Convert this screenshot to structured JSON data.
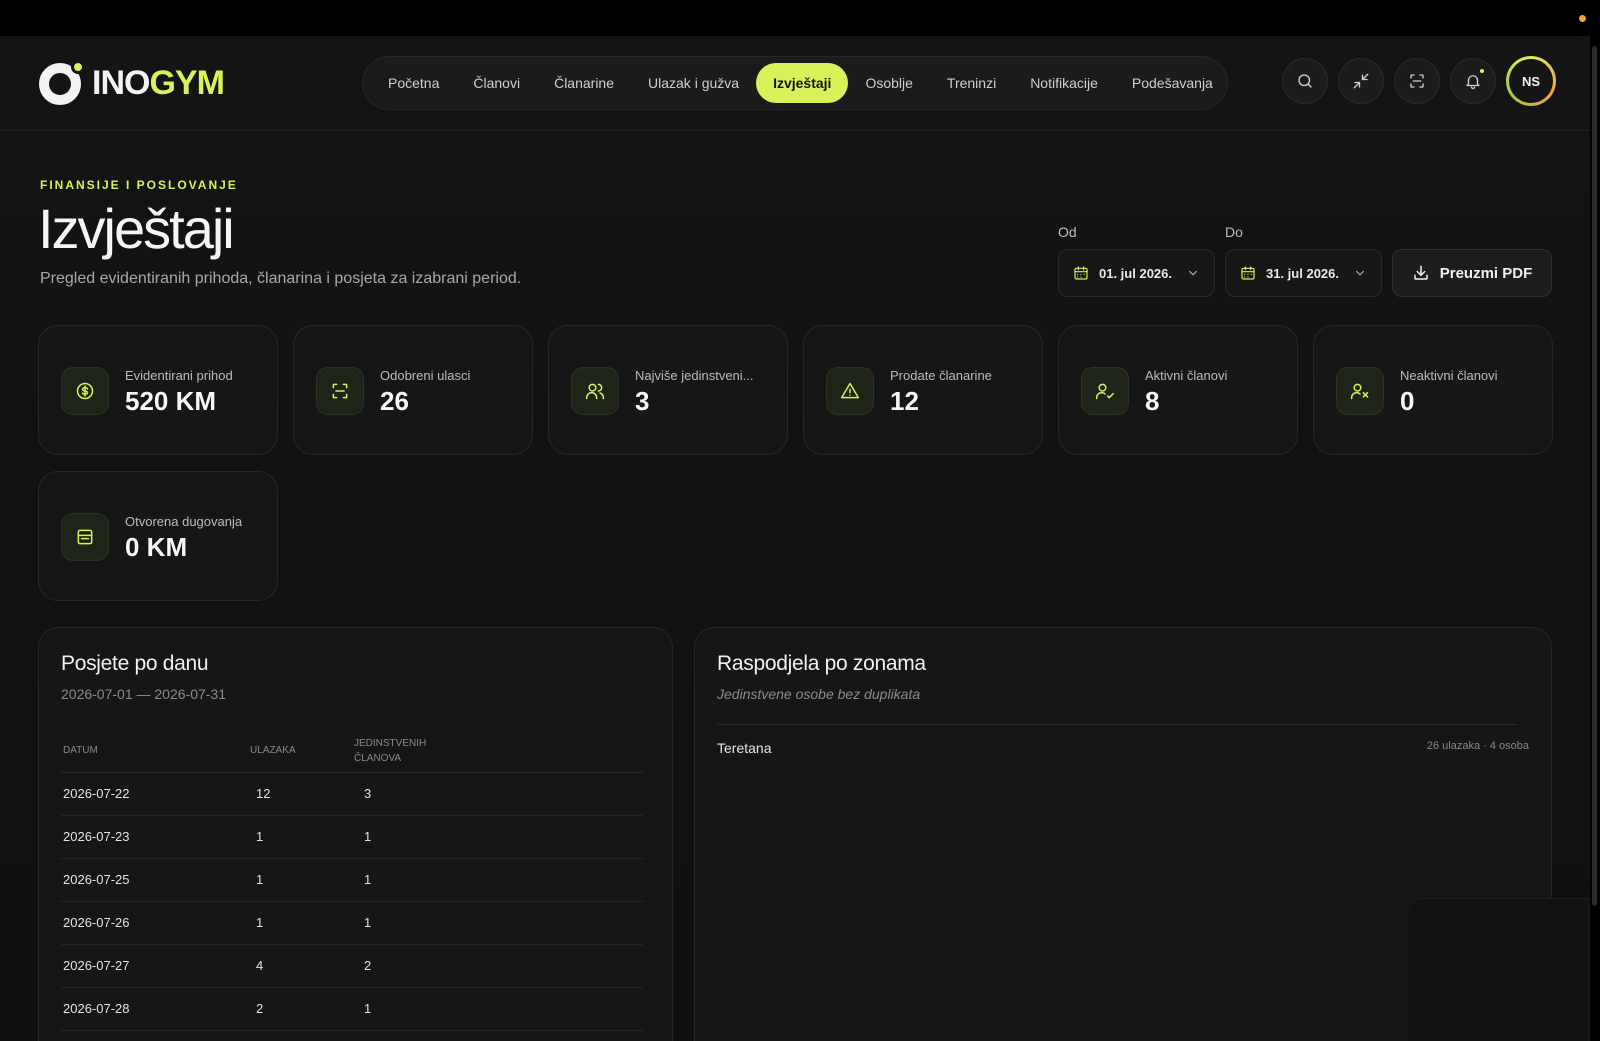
{
  "brand": {
    "name_part1": "INO",
    "name_part2": "GYM"
  },
  "nav": {
    "items": [
      {
        "label": "Početna"
      },
      {
        "label": "Članovi"
      },
      {
        "label": "Članarine"
      },
      {
        "label": "Ulazak i gužva"
      },
      {
        "label": "Izvještaji",
        "active": true
      },
      {
        "label": "Osoblje"
      },
      {
        "label": "Treninzi"
      },
      {
        "label": "Notifikacije"
      },
      {
        "label": "Podešavanja"
      }
    ]
  },
  "header_icons": [
    "search-icon",
    "collapse-icon",
    "scan-icon",
    "bell-icon"
  ],
  "user": {
    "initials": "NS"
  },
  "page": {
    "eyebrow": "FINANSIJE I POSLOVANJE",
    "title": "Izvještaji",
    "subtitle": "Pregled evidentiranih prihoda, članarina i posjeta za izabrani period."
  },
  "filters": {
    "from_label": "Od",
    "from_value": "01. jul 2026.",
    "to_label": "Do",
    "to_value": "31. jul 2026.",
    "pdf_label": "Preuzmi PDF"
  },
  "stats": [
    {
      "label": "Evidentirani prihod",
      "value": "520 KM",
      "icon": "dollar-icon"
    },
    {
      "label": "Odobreni ulasci",
      "value": "26",
      "icon": "scan-icon"
    },
    {
      "label": "Najviše jedinstveni...",
      "value": "3",
      "icon": "users-icon"
    },
    {
      "label": "Prodate članarine",
      "value": "12",
      "icon": "warning-icon"
    },
    {
      "label": "Aktivni članovi",
      "value": "8",
      "icon": "user-check-icon"
    },
    {
      "label": "Neaktivni članovi",
      "value": "0",
      "icon": "user-x-icon"
    },
    {
      "label": "Otvorena dugovanja",
      "value": "0 KM",
      "icon": "wallet-icon"
    }
  ],
  "visits_panel": {
    "title": "Posjete po danu",
    "subtitle": "2026-07-01 — 2026-07-31",
    "columns": [
      "DATUM",
      "ULAZAKA",
      "JEDINSTVENIH\nČLANOVA"
    ],
    "rows": [
      [
        "2026-07-22",
        "12",
        "3"
      ],
      [
        "2026-07-23",
        "1",
        "1"
      ],
      [
        "2026-07-25",
        "1",
        "1"
      ],
      [
        "2026-07-26",
        "1",
        "1"
      ],
      [
        "2026-07-27",
        "4",
        "2"
      ],
      [
        "2026-07-28",
        "2",
        "1"
      ]
    ]
  },
  "zones_panel": {
    "title": "Raspodjela po zonama",
    "subtitle": "Jedinstvene osobe bez duplikata",
    "zones": [
      {
        "name": "Teretana",
        "meta": "26 ulazaka · 4 osoba"
      }
    ]
  },
  "colors": {
    "accent": "#d8f35a",
    "background": "#121212",
    "card": "#161616"
  }
}
